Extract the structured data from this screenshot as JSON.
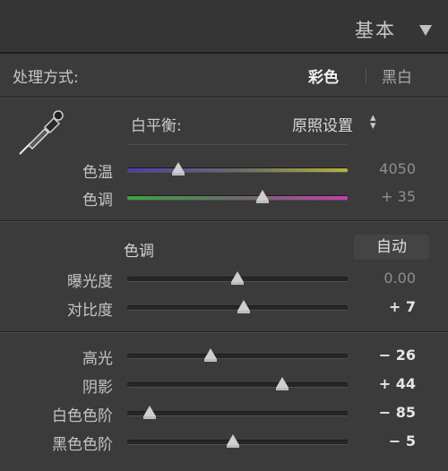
{
  "header": {
    "title": "基本"
  },
  "treatment": {
    "label": "处理方式:",
    "color": "彩色",
    "bw": "黑白"
  },
  "white_balance": {
    "label": "白平衡:",
    "preset": "原照设置",
    "sliders": [
      {
        "label": "色温",
        "value": "4050",
        "position": 0.23
      },
      {
        "label": "色调",
        "value": "+ 35",
        "position": 0.615
      }
    ]
  },
  "tone": {
    "label": "色调",
    "auto": "自动",
    "sliders": [
      {
        "label": "曝光度",
        "value": "0.00",
        "position": 0.5
      },
      {
        "label": "对比度",
        "value": "+ 7",
        "position": 0.53
      },
      {
        "label": "高光",
        "value": "− 26",
        "position": 0.38
      },
      {
        "label": "阴影",
        "value": "+ 44",
        "position": 0.705
      },
      {
        "label": "白色色阶",
        "value": "− 85",
        "position": 0.1
      },
      {
        "label": "黑色色阶",
        "value": "− 5",
        "position": 0.48
      }
    ]
  },
  "colors": {
    "temp_start": "#4a3fa8",
    "temp_end": "#b2b23a",
    "tint_start": "#3fa53f",
    "tint_end": "#c53fb0"
  }
}
